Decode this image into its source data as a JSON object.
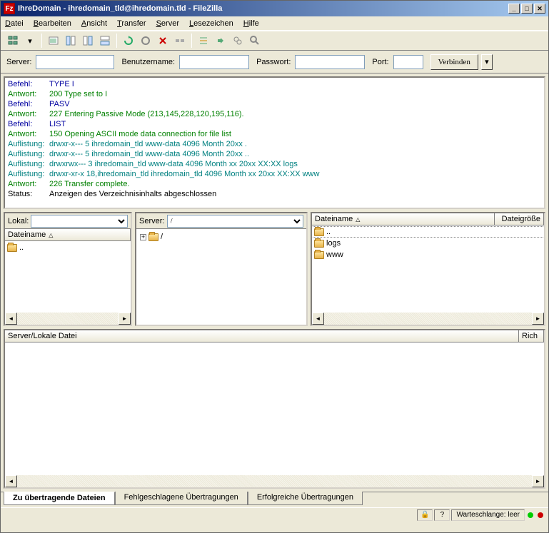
{
  "title": "IhreDomain - ihredomain_tld@ihredomain.tld - FileZilla",
  "app_icon_text": "Fz",
  "menu": {
    "datei": "Datei",
    "bearbeiten": "Bearbeiten",
    "ansicht": "Ansicht",
    "transfer": "Transfer",
    "server": "Server",
    "lesezeichen": "Lesezeichen",
    "hilfe": "Hilfe"
  },
  "quick": {
    "server": "Server:",
    "benutzer": "Benutzername:",
    "passwort": "Passwort:",
    "port": "Port:",
    "verbinden": "Verbinden"
  },
  "log": [
    {
      "type": "Befehl:",
      "text": "TYPE I",
      "color": "#0000a0"
    },
    {
      "type": "Antwort:",
      "text": "200 Type set to I",
      "color": "#008000"
    },
    {
      "type": "Befehl:",
      "text": "PASV",
      "color": "#0000a0"
    },
    {
      "type": "Antwort:",
      "text": "227 Entering Passive Mode (213,145,228,120,195,116).",
      "color": "#008000"
    },
    {
      "type": "Befehl:",
      "text": "LIST",
      "color": "#0000a0"
    },
    {
      "type": "Antwort:",
      "text": "150 Opening ASCII mode data connection for file list",
      "color": "#008000"
    },
    {
      "type": "Auflistung:",
      "text": "drwxr-x--- 5 ihredomain_tld www-data 4096 Month 20xx .",
      "color": "#008080"
    },
    {
      "type": "Auflistung:",
      "text": "drwxr-x--- 5 ihredomain_tld www-data 4096 Month 20xx ..",
      "color": "#008080"
    },
    {
      "type": "Auflistung:",
      "text": "drwxrwx--- 3 ihredomain_tld www-data 4096 Month xx 20xx XX:XX logs",
      "color": "#008080"
    },
    {
      "type": "Auflistung:",
      "text": "drwxr-xr-x 18,ihredomain_tld ihredomain_tld 4096 Month xx 20xx XX:XX www",
      "color": "#008080"
    },
    {
      "type": "Antwort:",
      "text": "226 Transfer complete.",
      "color": "#008000"
    },
    {
      "type": "Status:",
      "text": "Anzeigen des Verzeichnisinhalts abgeschlossen",
      "color": "#000000"
    }
  ],
  "local": {
    "label": "Lokal:",
    "col": "Dateiname",
    "up": ".."
  },
  "remote_tree": {
    "label": "Server:",
    "path": "/",
    "root": "/"
  },
  "remote_list": {
    "col_name": "Dateiname",
    "col_size": "Dateigröße",
    "items": [
      "..",
      "logs",
      "www"
    ]
  },
  "queue": {
    "col": "Server/Lokale Datei",
    "col_rich": "Rich"
  },
  "tabs": {
    "pending": "Zu übertragende Dateien",
    "failed": "Fehlgeschlagene Übertragungen",
    "success": "Erfolgreiche Übertragungen"
  },
  "status": {
    "queue": "Warteschlange: leer"
  }
}
